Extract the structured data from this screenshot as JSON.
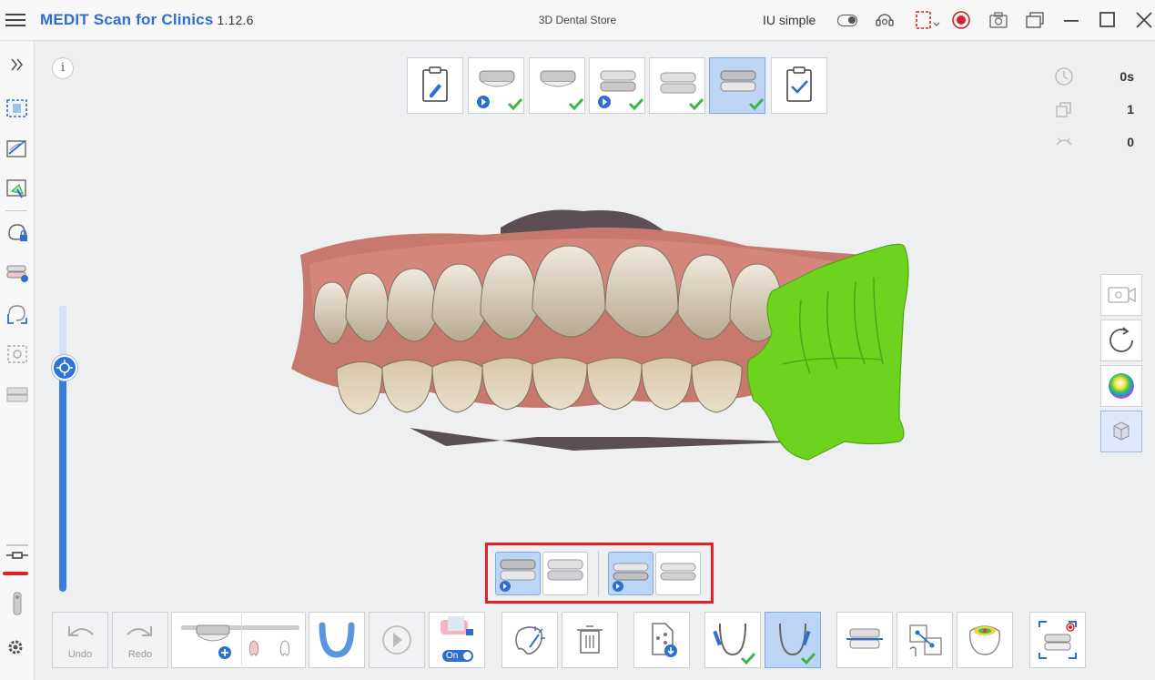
{
  "titlebar": {
    "brand": "MEDIT Scan for Clinics",
    "version": "1.12.6",
    "center_title": "3D Dental Store",
    "mode_label": "IU simple"
  },
  "info": {
    "label": "i"
  },
  "stats": [
    {
      "icon": "clock-icon",
      "value": "0s"
    },
    {
      "icon": "shots-icon",
      "value": "1"
    },
    {
      "icon": "scan-count-icon",
      "value": "0"
    }
  ],
  "bottom_toolbar": {
    "undo_label": "Undo",
    "redo_label": "Redo",
    "toggle_label": "On"
  },
  "colors": {
    "brand_blue": "#2c6fd1",
    "active_fill": "#bcd5f5",
    "highlight_red": "#e11f26",
    "scan_green": "#6dd31f",
    "check_green": "#3cb648"
  }
}
